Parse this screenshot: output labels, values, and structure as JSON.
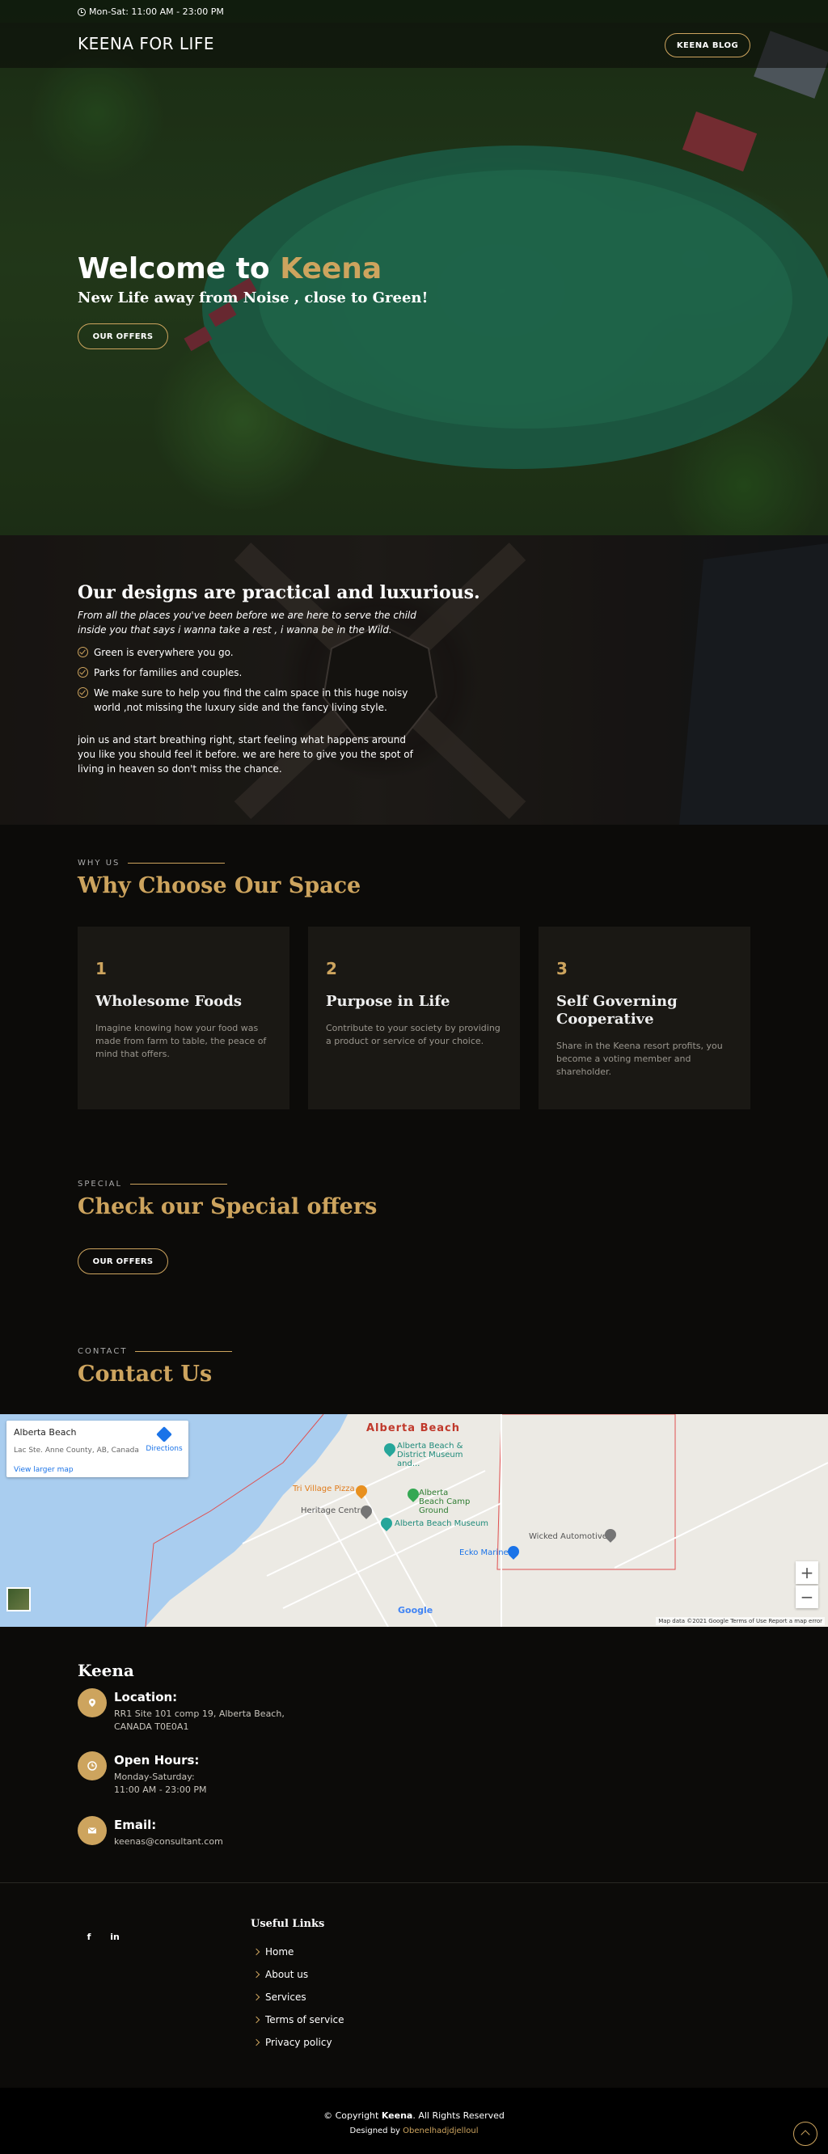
{
  "topbar": {
    "hours": "Mon-Sat: 11:00 AM - 23:00 PM"
  },
  "header": {
    "logo": "KEENA FOR LIFE",
    "blog_button": "KEENA BLOG"
  },
  "hero": {
    "title_prefix": "Welcome to",
    "title_highlight": "Keena",
    "subtitle": "New Life away from Noise , close to Green!",
    "offers_button": "OUR OFFERS"
  },
  "about": {
    "heading": "Our designs are practical and luxurious.",
    "intro": "From all the places you've been before we are here to serve the child inside you that says i wanna take a rest , i wanna be in the Wild.",
    "items": [
      "Green is everywhere you go.",
      "Parks for families and couples.",
      "We make sure to help you find the calm space in this huge noisy world ,not missing the luxury side and the fancy living style."
    ],
    "outro": "join us and start breathing right, start feeling what happens around you like you should feel it before. we are here to give you the spot of living in heaven so don't miss the chance."
  },
  "why": {
    "eyebrow": "WHY US",
    "title": "Why Choose Our Space",
    "cards": [
      {
        "num": "1",
        "title": "Wholesome Foods",
        "text": "Imagine knowing how your food was made from farm to table, the peace of mind that offers."
      },
      {
        "num": "2",
        "title": "Purpose in Life",
        "text": "Contribute to your society by providing a product or service of your choice."
      },
      {
        "num": "3",
        "title": "Self Governing Cooperative",
        "text": "Share in the Keena resort profits, you become a voting member and shareholder."
      }
    ]
  },
  "special": {
    "eyebrow": "SPECIAL",
    "title": "Check our Special offers",
    "offers_button": "OUR OFFERS"
  },
  "contact": {
    "eyebrow": "CONTACT",
    "title": "Contact Us"
  },
  "map": {
    "place": "Alberta Beach",
    "address": "Lac Ste. Anne County, AB, Canada",
    "directions": "Directions",
    "larger": "View larger map",
    "town_label": "Alberta Beach",
    "poi": [
      "Alberta Beach & District Museum and...",
      "Tri Village Pizza",
      "Alberta Beach Camp Ground",
      "Heritage Centre",
      "Alberta Beach Museum",
      "Ecko Marine",
      "Wicked Automotive"
    ],
    "footer": "Map data ©2021 Google   Terms of Use   Report a map error",
    "google": "Google",
    "zoom_in": "+",
    "zoom_out": "−"
  },
  "info": {
    "title": "Keena",
    "location_label": "Location:",
    "location_line1": "RR1 Site 101 comp 19, Alberta Beach,",
    "location_line2": "CANADA T0E0A1",
    "hours_label": "Open Hours:",
    "hours_line1": "Monday-Saturday:",
    "hours_line2": "11:00 AM - 23:00 PM",
    "email_label": "Email:",
    "email": "keenas@consultant.com"
  },
  "footer": {
    "social": [
      "f",
      "in"
    ],
    "links_title": "Useful Links",
    "links": [
      "Home",
      "About us",
      "Services",
      "Terms of service",
      "Privacy policy"
    ],
    "copyright_pre": "© Copyright",
    "copyright_brand": "Keena",
    "copyright_post": ". All Rights Reserved",
    "designed_by": "Designed by",
    "designer": "Obenelhadjdjelloul"
  },
  "colors": {
    "accent": "#cda45e",
    "background": "#0c0b09",
    "card": "#1a1814"
  }
}
